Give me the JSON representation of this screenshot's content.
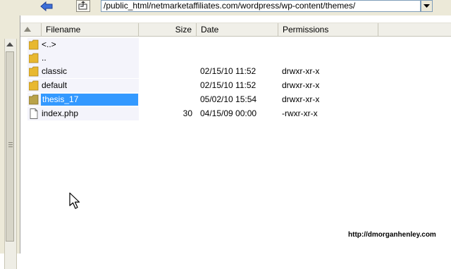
{
  "toolbar": {
    "path": "/public_html/netmarketaffiliates.com/wordpress/wp-content/themes/"
  },
  "columns": {
    "filename": "Filename",
    "size": "Size",
    "date": "Date",
    "permissions": "Permissions"
  },
  "files": [
    {
      "name": "<..>",
      "size": "",
      "date": "",
      "permissions": "",
      "type": "folder"
    },
    {
      "name": "..",
      "size": "",
      "date": "",
      "permissions": "",
      "type": "folder"
    },
    {
      "name": "classic",
      "size": "",
      "date": "02/15/10  11:52",
      "permissions": "drwxr-xr-x",
      "type": "folder"
    },
    {
      "name": "default",
      "size": "",
      "date": "02/15/10  11:52",
      "permissions": "drwxr-xr-x",
      "type": "folder"
    },
    {
      "name": "thesis_17",
      "size": "",
      "date": "05/02/10  15:54",
      "permissions": "drwxr-xr-x",
      "type": "folder",
      "selected": true
    },
    {
      "name": "index.php",
      "size": "30",
      "date": "04/15/09  00:00",
      "permissions": "-rwxr-xr-x",
      "type": "file"
    }
  ],
  "watermark": "http://dmorganhenley.com",
  "colors": {
    "selection": "#3399ff",
    "folder": "#e8b830",
    "chrome": "#ece9d8"
  }
}
